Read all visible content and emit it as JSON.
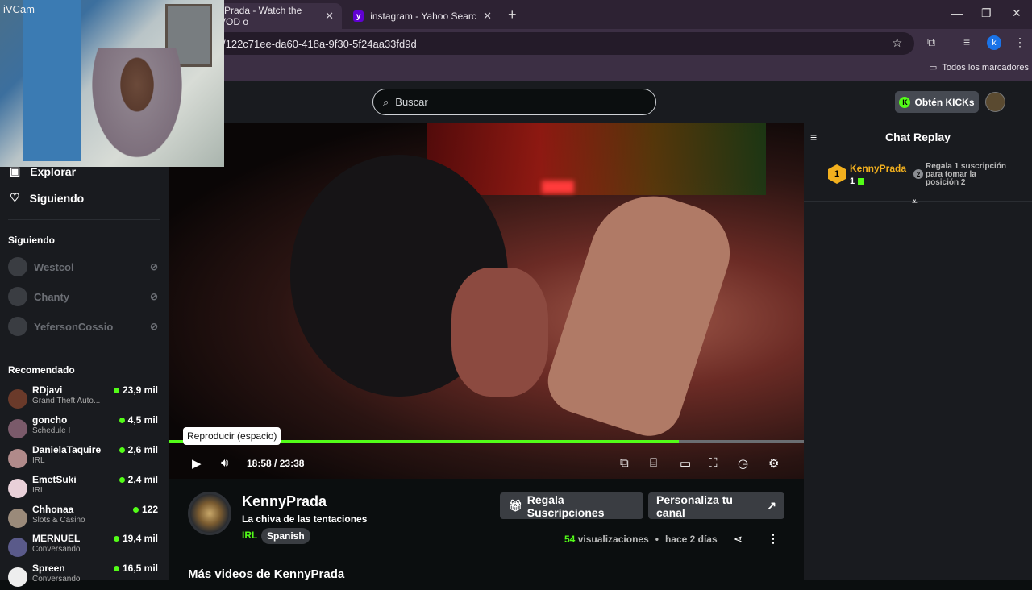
{
  "browser": {
    "tabs": [
      {
        "label": "yPrada - Watch the VOD o"
      },
      {
        "label": "instagram - Yahoo Search Tus r"
      }
    ],
    "url": "/122c71ee-da60-418a-9f30-5f24aa33fd9d",
    "bookmarks_label": "Todos los marcadores",
    "profile_initial": "k"
  },
  "webcam": {
    "label": "iVCam"
  },
  "header": {
    "search_placeholder": "Buscar",
    "get_kicks_label": "Obtén KICKs"
  },
  "sidebar": {
    "nav": [
      {
        "label": "Explorar"
      },
      {
        "label": "Siguiendo"
      }
    ],
    "following_title": "Siguiendo",
    "following": [
      {
        "name": "Westcol"
      },
      {
        "name": "Chanty"
      },
      {
        "name": "YefersonCossio"
      }
    ],
    "recommended_title": "Recomendado",
    "recommended": [
      {
        "name": "RDjavi",
        "category": "Grand Theft Auto...",
        "viewers": "23,9 mil"
      },
      {
        "name": "goncho",
        "category": "Schedule I",
        "viewers": "4,5 mil"
      },
      {
        "name": "DanielaTaquire",
        "category": "IRL",
        "viewers": "2,6 mil"
      },
      {
        "name": "EmetSuki",
        "category": "IRL",
        "viewers": "2,4 mil"
      },
      {
        "name": "Chhonaa",
        "category": "Slots & Casino",
        "viewers": "122"
      },
      {
        "name": "MERNUEL",
        "category": "Conversando",
        "viewers": "19,4 mil"
      },
      {
        "name": "Spreen",
        "category": "Conversando",
        "viewers": "16,5 mil"
      }
    ]
  },
  "player": {
    "tooltip": "Reproducir (espacio)",
    "current_time": "18:58",
    "separator": "/",
    "duration": "23:38",
    "progress_fraction": 0.8025
  },
  "channel": {
    "name": "KennyPrada",
    "title": "La chiva de las tentaciones",
    "category": "IRL",
    "language": "Spanish",
    "gift_button": "Regala Suscripciones",
    "customize_button": "Personaliza tu canal",
    "views_count": "54",
    "views_label": "visualizaciones",
    "bullet": "•",
    "posted": "hace 2 días",
    "more_videos_title": "Más videos de KennyPrada"
  },
  "chat": {
    "title": "Chat Replay",
    "top_gifter": {
      "rank": "1",
      "name": "KennyPrada",
      "count": "1"
    },
    "position2": {
      "rank": "2",
      "text": "Regala 1 suscripción para tomar la posición 2"
    }
  },
  "colors": {
    "accent": "#53fc18",
    "gold": "#f2b01e",
    "chrome": "#3c2f44"
  }
}
